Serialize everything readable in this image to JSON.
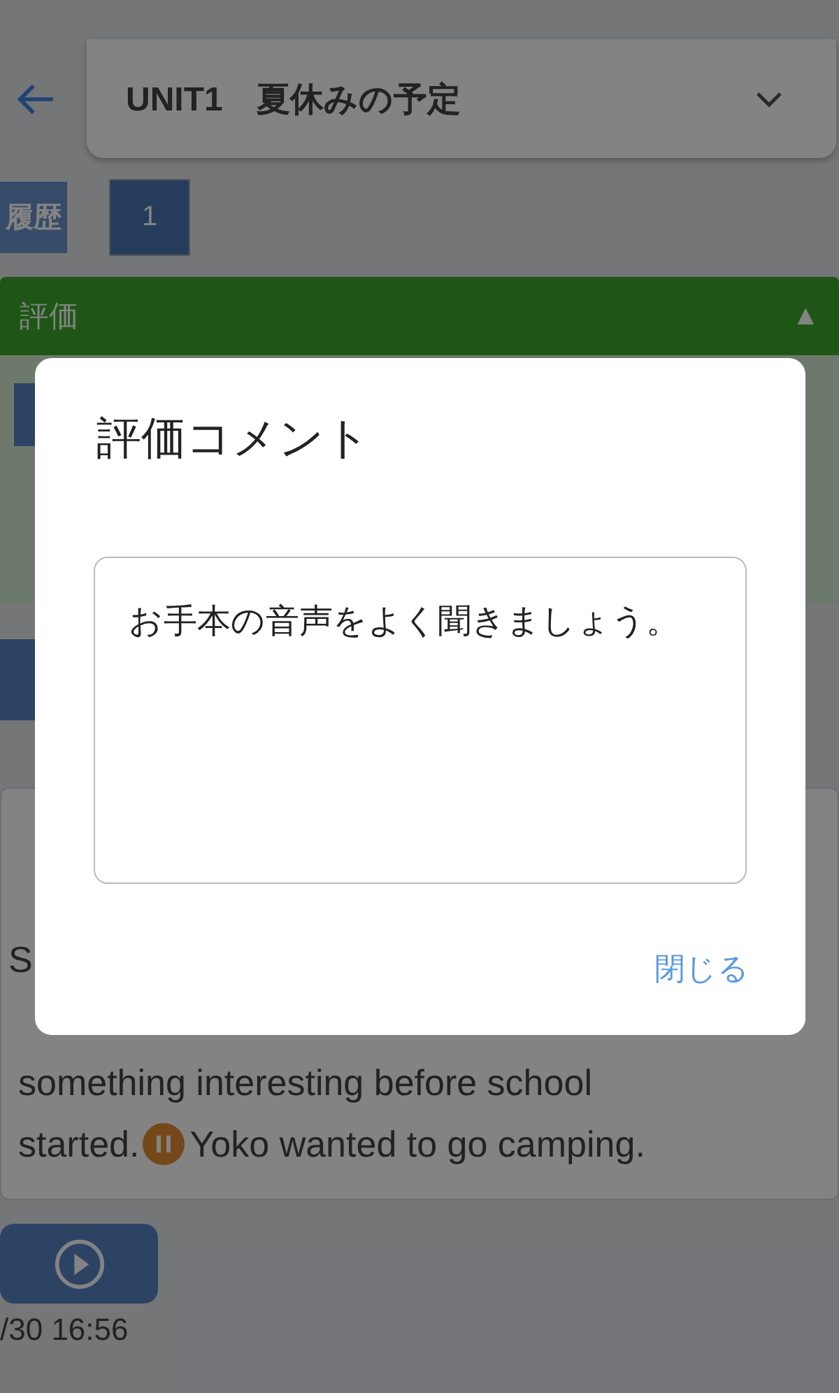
{
  "header": {
    "title": "UNIT1　夏休みの予定"
  },
  "history": {
    "label": "履歴",
    "pages": [
      {
        "label": "1",
        "selected": true
      }
    ]
  },
  "evaluation": {
    "title": "評価",
    "toggle": "▲",
    "expanded": true
  },
  "passage": {
    "lines": [
      [
        {
          "kind": "text",
          "text": "S"
        }
      ],
      [
        {
          "kind": "text",
          "text": "something interesting before school"
        }
      ],
      [
        {
          "kind": "text",
          "text": "started."
        },
        {
          "kind": "pause"
        },
        {
          "kind": "text",
          "text": " Yoko wanted to go camping."
        }
      ]
    ]
  },
  "footer": {
    "date": "/30 16:56"
  },
  "dialog": {
    "title": "評価コメント",
    "comment": "お手本の音声をよく聞きましょう。",
    "close": "閉じる"
  }
}
